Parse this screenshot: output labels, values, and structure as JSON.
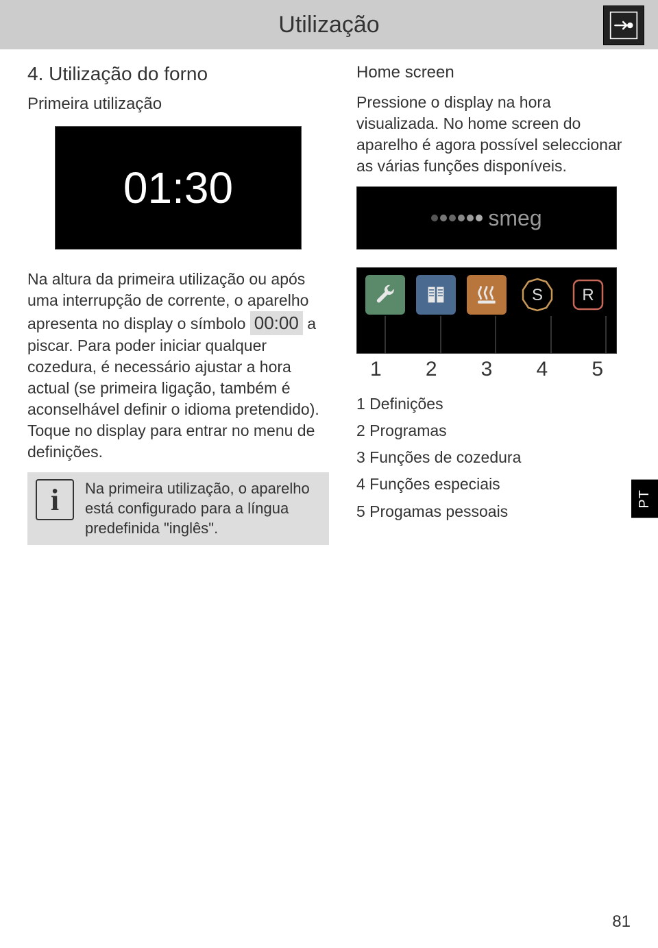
{
  "header": {
    "title": "Utilização"
  },
  "left": {
    "section_title": "4. Utilização do forno",
    "subhead": "Primeira utilização",
    "clock": "01:30",
    "para1a": "Na altura da primeira utilização ou após uma interrupção de corrente, o aparelho apresenta no display o símbolo ",
    "blink_time": "00:00",
    "para1b": " a piscar. Para poder iniciar qualquer cozedura, é necessário ajustar a hora actual (se primeira ligação, também é aconselhável definir o idioma pretendido). Toque no display para entrar no menu de definições.",
    "info": "Na primeira utilização, o aparelho está configurado para a língua predefinida \"inglês\"."
  },
  "right": {
    "hs_title": "Home screen",
    "hs_para": "Pressione o display na hora visualizada. No home screen do aparelho é agora possível seleccionar as várias funções disponíveis.",
    "brand": "smeg",
    "icon_badge_s": "S",
    "icon_badge_r": "R",
    "numbers": [
      "1",
      "2",
      "3",
      "4",
      "5"
    ],
    "legend": [
      "1 Definições",
      "2 Programas",
      "3 Funções de cozedura",
      "4 Funções especiais",
      "5 Progamas pessoais"
    ]
  },
  "side_tab": "PT",
  "page_number": "81"
}
